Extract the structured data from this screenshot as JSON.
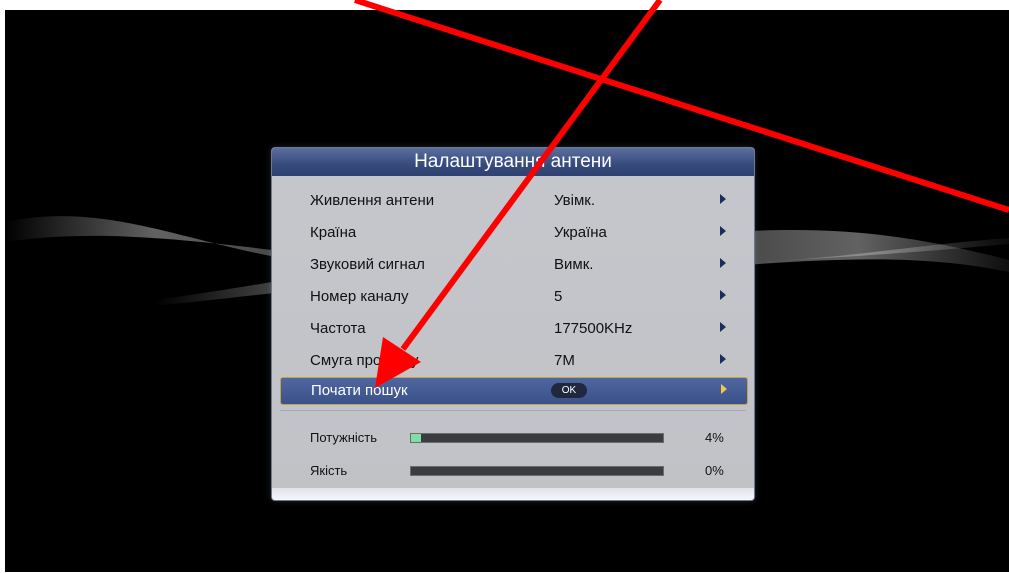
{
  "dialog": {
    "title": "Налаштування антени"
  },
  "rows": [
    {
      "label": "Живлення антени",
      "value": "Увімк."
    },
    {
      "label": "Країна",
      "value": "Україна"
    },
    {
      "label": "Звуковий сигнал",
      "value": "Вимк."
    },
    {
      "label": "Номер каналу",
      "value": "5"
    },
    {
      "label": "Частота",
      "value": "177500KHz"
    },
    {
      "label": "Смуга пропуску",
      "value": "7M"
    }
  ],
  "start_search": {
    "label": "Почати пошук",
    "button": "OK"
  },
  "meters": {
    "power": {
      "label": "Потужність",
      "value": 4,
      "text": "4%"
    },
    "quality": {
      "label": "Якість",
      "value": 0,
      "text": "0%"
    }
  },
  "colors": {
    "annotation": "#ff0000",
    "selection": "#3b5189",
    "meter_fill": "#7fdfa6"
  },
  "icons": {
    "row_arrow": "triangle-right-icon"
  }
}
